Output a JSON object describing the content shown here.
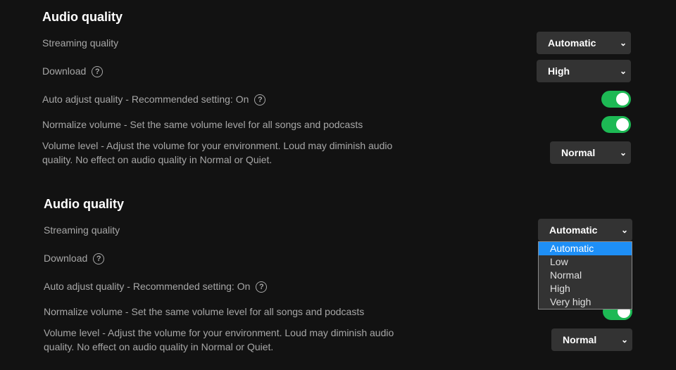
{
  "sections": [
    {
      "title": "Audio quality",
      "streaming_label": "Streaming quality",
      "streaming_value": "Automatic",
      "download_label": "Download",
      "download_value": "High",
      "auto_adjust_label": "Auto adjust quality - Recommended setting: On",
      "auto_adjust_on": true,
      "normalize_label": "Normalize volume - Set the same volume level for all songs and podcasts",
      "normalize_on": true,
      "volume_label": "Volume level - Adjust the volume for your environment. Loud may diminish audio quality. No effect on audio quality in Normal or Quiet.",
      "volume_value": "Normal"
    },
    {
      "title": "Audio quality",
      "streaming_label": "Streaming quality",
      "streaming_value": "Automatic",
      "download_label": "Download",
      "auto_adjust_label": "Auto adjust quality - Recommended setting: On",
      "normalize_label": "Normalize volume - Set the same volume level for all songs and podcasts",
      "normalize_on": true,
      "volume_label": "Volume level - Adjust the volume for your environment. Loud may diminish audio quality. No effect on audio quality in Normal or Quiet.",
      "volume_value": "Normal"
    }
  ],
  "dropdown": {
    "options": [
      "Automatic",
      "Low",
      "Normal",
      "High",
      "Very high"
    ],
    "selected": "Automatic"
  },
  "help_glyph": "?",
  "chevron_glyph": "⌄",
  "colors": {
    "background": "#121212",
    "toggle_on": "#1db954",
    "highlight": "#1e8ff6",
    "select_bg": "#333333"
  }
}
